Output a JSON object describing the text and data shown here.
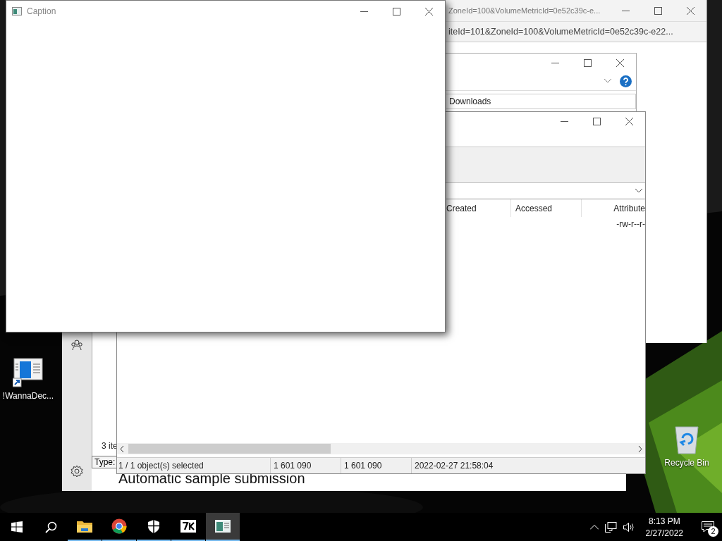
{
  "desktop": {
    "icons": [
      {
        "label": "!WannaDec...",
        "kind": "shortcut"
      },
      {
        "label": "Recycle Bin",
        "kind": "recycle-bin"
      }
    ]
  },
  "browser_window": {
    "title": "ZoneId=100&VolumeMetricId=0e52c39c-e...",
    "address": "iteId=101&ZoneId=100&VolumeMetricId=0e52c39c-e22..."
  },
  "security_window": {
    "heading": "Automatic sample submission"
  },
  "explorer_window": {
    "address": "Downloads",
    "status": "3 ite",
    "tooltip": "Type:"
  },
  "file_manager": {
    "columns": [
      "Created",
      "Accessed",
      "Attribute"
    ],
    "rows": [
      {
        "attributes": "-rw-r--r-"
      }
    ],
    "status": [
      "1 / 1 object(s) selected",
      "1 601 090",
      "1 601 090",
      "2022-02-27 21:58:04"
    ]
  },
  "caption_window": {
    "title": "Caption"
  },
  "taskbar": {
    "apps": [
      {
        "kind": "folder",
        "running": true,
        "selected": false
      },
      {
        "kind": "browser",
        "running": true,
        "selected": false
      },
      {
        "kind": "shield",
        "running": true,
        "selected": false
      },
      {
        "kind": "archiver",
        "running": true,
        "selected": false
      },
      {
        "kind": "window",
        "running": true,
        "selected": true
      }
    ],
    "time": "8:13 PM",
    "date": "2/27/2022",
    "notifications": "2"
  }
}
